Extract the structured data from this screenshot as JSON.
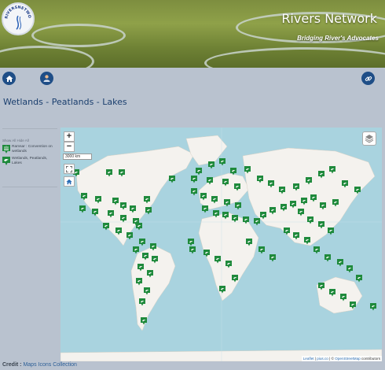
{
  "header": {
    "logo_text": "RIVERSNETWORK.ORG",
    "title": "Rivers Network",
    "tagline": "Bridging River's Advocates"
  },
  "nav": {
    "home_icon": "home-icon",
    "user_icon": "user-icon",
    "link_icon": "link-icon"
  },
  "page": {
    "heading": "Wetlands - Peatlands - Lakes"
  },
  "legend": {
    "show_hide": "Show All Hide All",
    "items": [
      {
        "label": "Ramsar : Convention on wetlands",
        "icon": "wetland-marker-icon"
      },
      {
        "label": "Wetlands, Peatlands, Lakes",
        "icon": "bird-marker-icon"
      }
    ]
  },
  "map": {
    "zoom_in": "+",
    "zoom_out": "−",
    "scale": "3000 km",
    "attribution_leaflet": "Leaflet",
    "attribution_sep1": " | ",
    "attribution_pinjs": "pius.co",
    "attribution_sep2": " | © ",
    "attribution_osm": "OpenStreetMap",
    "attribution_contrib": " contributors",
    "colors": {
      "water": "#a9d3df",
      "land": "#f4f2ee",
      "marker": "#1f8a3c"
    }
  },
  "footer": {
    "credit_label": "Credit :",
    "credit_source": "Maps Icons Collection"
  }
}
